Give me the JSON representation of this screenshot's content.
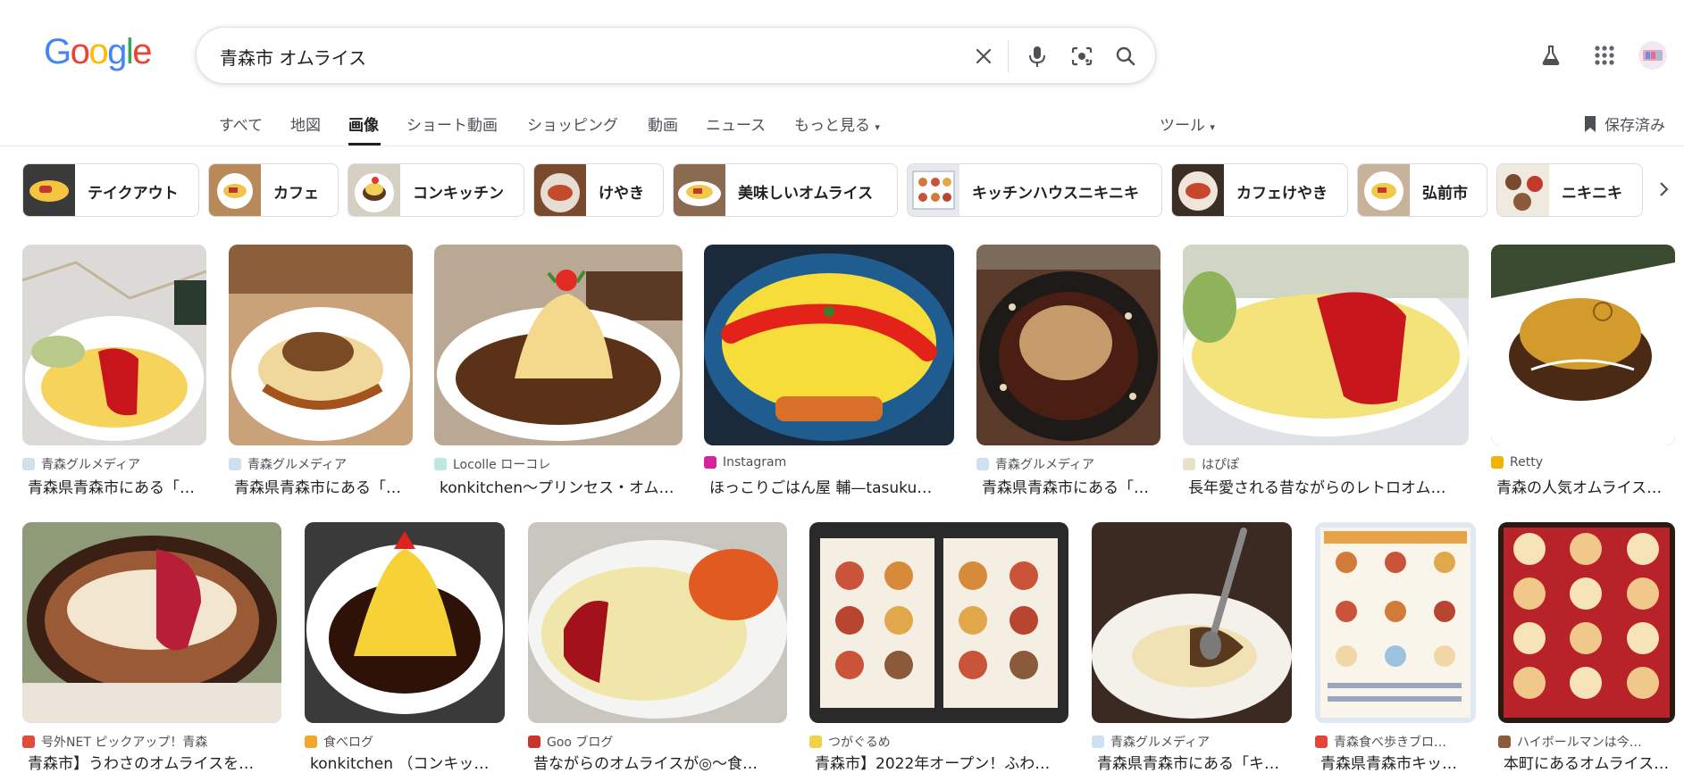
{
  "header": {
    "logo": [
      "G",
      "o",
      "o",
      "g",
      "l",
      "e"
    ],
    "logo_colors": [
      "#4285F4",
      "#EA4335",
      "#FBBC05",
      "#4285F4",
      "#34A853",
      "#EA4335"
    ],
    "query": "青森市 オムライス",
    "icons": [
      "clear-icon",
      "mic-icon",
      "lens-icon",
      "search-icon",
      "labs-flask-icon",
      "apps-grid-icon",
      "avatar"
    ]
  },
  "tabs": {
    "items": [
      "すべて",
      "地図",
      "画像",
      "ショート動画",
      "ショッピング",
      "動画",
      "ニュース",
      "もっと見る"
    ],
    "active": "画像",
    "more_caret": "▾",
    "tools": "ツール",
    "saved": "保存済み"
  },
  "chips": [
    {
      "label": "テイクアウト"
    },
    {
      "label": "カフェ"
    },
    {
      "label": "コンキッチン"
    },
    {
      "label": "けやき"
    },
    {
      "label": "美味しいオムライス"
    },
    {
      "label": "キッチンハウスニキニキ"
    },
    {
      "label": "カフェけやき"
    },
    {
      "label": "弘前市"
    },
    {
      "label": "ニキニキ"
    }
  ],
  "results_row1": [
    {
      "source": "青森グルメディア",
      "title": "青森県青森市にある「…"
    },
    {
      "source": "青森グルメディア",
      "title": "青森県青森市にある「…"
    },
    {
      "source": "Locolle ローコレ",
      "title": "konkitchen〜プリンセス・オム…"
    },
    {
      "source": "Instagram",
      "title": "ほっこりごはん屋 輔—tasuku…"
    },
    {
      "source": "青森グルメディア",
      "title": "青森県青森市にある「…"
    },
    {
      "source": "はぴぽ",
      "title": "長年愛される昔ながらのレトロオム…"
    },
    {
      "source": "Retty",
      "title": "青森の人気オムライス…"
    }
  ],
  "results_row2": [
    {
      "source": "号外NET ピックアップ！青森",
      "title": "青森市】うわさのオムライスを…"
    },
    {
      "source": "食べログ",
      "title": "konkitchen （コンキッ…"
    },
    {
      "source": "Goo ブログ",
      "title": "昔ながらのオムライスが◎〜食…"
    },
    {
      "source": "つがぐるめ",
      "title": "青森市】2022年オープン！ふわ…"
    },
    {
      "source": "青森グルメディア",
      "title": "青森県青森市にある「キ…"
    },
    {
      "source": "青森食べ歩きブロ…",
      "title": "青森県青森市キッ…"
    },
    {
      "source": "ハイボールマンは今…",
      "title": "本町にあるオムライス専…"
    }
  ],
  "colors": {
    "accent": "#1a73e8",
    "text": "#202124",
    "muted": "#4d5156"
  }
}
